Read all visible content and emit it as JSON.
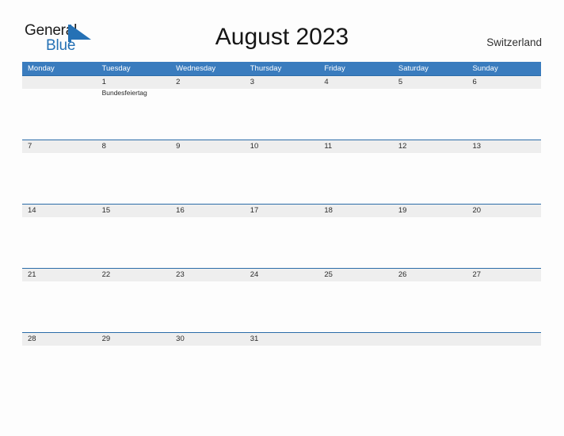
{
  "brand": {
    "name_part1": "General",
    "name_part2": "Blue",
    "mark_icon": "triangle-mark-icon",
    "accent_color": "#2571b5"
  },
  "header": {
    "title": "August 2023",
    "country": "Switzerland"
  },
  "theme": {
    "header_blue": "#3a7cbe",
    "band_gray": "#eeeeee",
    "band_line": "#2b6ca8",
    "page_bg": "#fdfdfd",
    "text": "#2a2a2a"
  },
  "calendar": {
    "month": "August",
    "year": "2023",
    "weekday_headers": [
      "Monday",
      "Tuesday",
      "Wednesday",
      "Thursday",
      "Friday",
      "Saturday",
      "Sunday"
    ],
    "weeks": [
      [
        {
          "date": "",
          "event": ""
        },
        {
          "date": "1",
          "event": "Bundesfeiertag"
        },
        {
          "date": "2",
          "event": ""
        },
        {
          "date": "3",
          "event": ""
        },
        {
          "date": "4",
          "event": ""
        },
        {
          "date": "5",
          "event": ""
        },
        {
          "date": "6",
          "event": ""
        }
      ],
      [
        {
          "date": "7",
          "event": ""
        },
        {
          "date": "8",
          "event": ""
        },
        {
          "date": "9",
          "event": ""
        },
        {
          "date": "10",
          "event": ""
        },
        {
          "date": "11",
          "event": ""
        },
        {
          "date": "12",
          "event": ""
        },
        {
          "date": "13",
          "event": ""
        }
      ],
      [
        {
          "date": "14",
          "event": ""
        },
        {
          "date": "15",
          "event": ""
        },
        {
          "date": "16",
          "event": ""
        },
        {
          "date": "17",
          "event": ""
        },
        {
          "date": "18",
          "event": ""
        },
        {
          "date": "19",
          "event": ""
        },
        {
          "date": "20",
          "event": ""
        }
      ],
      [
        {
          "date": "21",
          "event": ""
        },
        {
          "date": "22",
          "event": ""
        },
        {
          "date": "23",
          "event": ""
        },
        {
          "date": "24",
          "event": ""
        },
        {
          "date": "25",
          "event": ""
        },
        {
          "date": "26",
          "event": ""
        },
        {
          "date": "27",
          "event": ""
        }
      ],
      [
        {
          "date": "28",
          "event": ""
        },
        {
          "date": "29",
          "event": ""
        },
        {
          "date": "30",
          "event": ""
        },
        {
          "date": "31",
          "event": ""
        },
        {
          "date": "",
          "event": ""
        },
        {
          "date": "",
          "event": ""
        },
        {
          "date": "",
          "event": ""
        }
      ]
    ]
  }
}
